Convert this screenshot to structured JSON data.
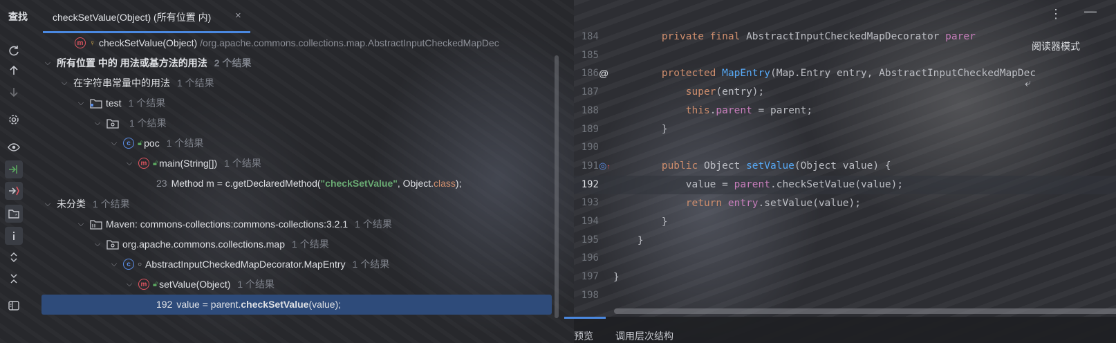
{
  "header": {
    "title": "查找",
    "tab_label": "checkSetValue(Object) (所有位置 内)",
    "tab_close": "×"
  },
  "tree": {
    "top_item": {
      "name": "checkSetValue(Object)",
      "path": "/org.apache.commons.collections.map.AbstractInputCheckedMapDec"
    },
    "all_usages": {
      "label": "所有位置 中的 用法或基方法的用法",
      "count": "2 个结果"
    },
    "string_const": {
      "label": "在字符串常量中的用法",
      "count": "1 个结果"
    },
    "test": {
      "label": "test",
      "count": "1 个结果"
    },
    "pkg_default": {
      "label": "",
      "count": "1 个结果"
    },
    "poc": {
      "label": "poc",
      "count": "1 个结果"
    },
    "main": {
      "label": "main(String[])",
      "count": "1 个结果"
    },
    "line23": {
      "num": "23",
      "pre": "Method m = c.getDeclaredMethod(",
      "str": "\"checkSetValue\"",
      "mid": ", Object.",
      "cls": "class",
      "post": ");"
    },
    "uncategorized": {
      "label": "未分类",
      "count": "1 个结果"
    },
    "maven": {
      "label": "Maven: commons-collections:commons-collections:3.2.1",
      "count": "1 个结果"
    },
    "map_pkg": {
      "label": "org.apache.commons.collections.map",
      "count": "1 个结果"
    },
    "map_entry": {
      "label": "AbstractInputCheckedMapDecorator.MapEntry",
      "count": "1 个结果"
    },
    "set_value": {
      "label": "setValue(Object)",
      "count": "1 个结果"
    },
    "line192": {
      "num": "192",
      "pre": "value = parent.",
      "bold": "checkSetValue",
      "post": "(value);"
    }
  },
  "editor": {
    "line_numbers": [
      "184",
      "185",
      "186",
      "187",
      "188",
      "189",
      "190",
      "191",
      "192",
      "193",
      "194",
      "195",
      "196",
      "197",
      "198"
    ],
    "current_line": "192",
    "reader_mode": "阅读器模式",
    "bottom_tabs": [
      "预览",
      "调用层次结构"
    ]
  },
  "colors": {
    "accent": "#4a88e0",
    "selection": "#2e4b7a",
    "keyword": "#cf8e6d",
    "function": "#56a8f5",
    "field": "#c77dbb",
    "string": "#6aab73"
  }
}
